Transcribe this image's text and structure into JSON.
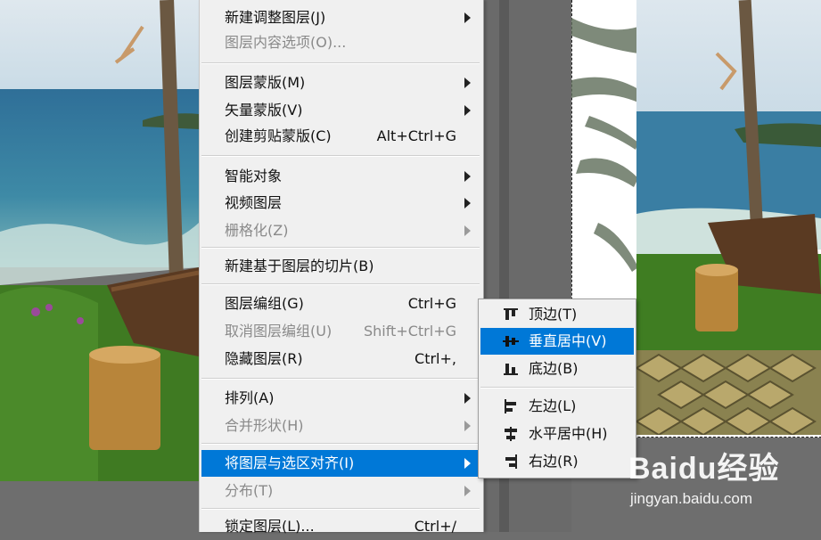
{
  "menu": {
    "items": [
      {
        "label": "新建调整图层(J)",
        "shortcut": "",
        "submenu": true,
        "disabled": false
      },
      {
        "label": "图层内容选项(O)...",
        "shortcut": "",
        "submenu": false,
        "disabled": true
      },
      {
        "label": "图层蒙版(M)",
        "shortcut": "",
        "submenu": true,
        "disabled": false
      },
      {
        "label": "矢量蒙版(V)",
        "shortcut": "",
        "submenu": true,
        "disabled": false
      },
      {
        "label": "创建剪贴蒙版(C)",
        "shortcut": "Alt+Ctrl+G",
        "submenu": false,
        "disabled": false
      },
      {
        "label": "智能对象",
        "shortcut": "",
        "submenu": true,
        "disabled": false
      },
      {
        "label": "视频图层",
        "shortcut": "",
        "submenu": true,
        "disabled": false
      },
      {
        "label": "栅格化(Z)",
        "shortcut": "",
        "submenu": true,
        "disabled": true
      },
      {
        "label": "新建基于图层的切片(B)",
        "shortcut": "",
        "submenu": false,
        "disabled": false
      },
      {
        "label": "图层编组(G)",
        "shortcut": "Ctrl+G",
        "submenu": false,
        "disabled": false
      },
      {
        "label": "取消图层编组(U)",
        "shortcut": "Shift+Ctrl+G",
        "submenu": false,
        "disabled": true
      },
      {
        "label": "隐藏图层(R)",
        "shortcut": "Ctrl+,",
        "submenu": false,
        "disabled": false
      },
      {
        "label": "排列(A)",
        "shortcut": "",
        "submenu": true,
        "disabled": false
      },
      {
        "label": "合并形状(H)",
        "shortcut": "",
        "submenu": true,
        "disabled": true
      },
      {
        "label": "将图层与选区对齐(I)",
        "shortcut": "",
        "submenu": true,
        "disabled": false,
        "highlighted": true
      },
      {
        "label": "分布(T)",
        "shortcut": "",
        "submenu": true,
        "disabled": true
      },
      {
        "label": "锁定图层(L)...",
        "shortcut": "Ctrl+/",
        "submenu": false,
        "disabled": false
      }
    ]
  },
  "submenu": {
    "items": [
      {
        "label": "顶边(T)",
        "icon": "align-top-icon"
      },
      {
        "label": "垂直居中(V)",
        "icon": "align-vertical-center-icon",
        "highlighted": true
      },
      {
        "label": "底边(B)",
        "icon": "align-bottom-icon"
      },
      {
        "label": "左边(L)",
        "icon": "align-left-icon"
      },
      {
        "label": "水平居中(H)",
        "icon": "align-horizontal-center-icon"
      },
      {
        "label": "右边(R)",
        "icon": "align-right-icon"
      }
    ]
  },
  "watermark": {
    "brand": "Baidu经验",
    "url": "jingyan.baidu.com"
  },
  "colors": {
    "highlight": "#0078d7",
    "menu_bg": "#f0f0f0",
    "disabled_text": "#8a8a8a"
  }
}
